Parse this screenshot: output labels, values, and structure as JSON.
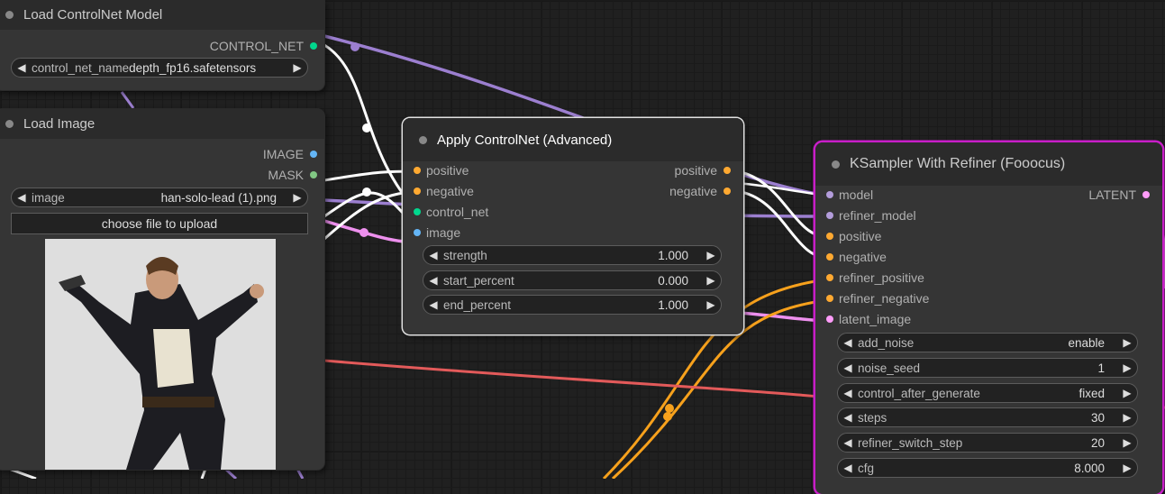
{
  "nodes": {
    "load_controlnet": {
      "title": "Load ControlNet Model",
      "output": "CONTROL_NET",
      "widget": {
        "name": "control_net_name",
        "value": "depth_fp16.safetensors"
      }
    },
    "load_image": {
      "title": "Load Image",
      "outputs": [
        "IMAGE",
        "MASK"
      ],
      "widget": {
        "name": "image",
        "value": "han-solo-lead (1).png"
      },
      "upload_label": "choose file to upload"
    },
    "apply_controlnet": {
      "title": "Apply ControlNet (Advanced)",
      "inputs": [
        "positive",
        "negative",
        "control_net",
        "image"
      ],
      "outputs": [
        "positive",
        "negative"
      ],
      "widgets": [
        {
          "name": "strength",
          "value": "1.000"
        },
        {
          "name": "start_percent",
          "value": "0.000"
        },
        {
          "name": "end_percent",
          "value": "1.000"
        }
      ]
    },
    "ksampler": {
      "title": "KSampler With Refiner (Fooocus)",
      "inputs": [
        "model",
        "refiner_model",
        "positive",
        "negative",
        "refiner_positive",
        "refiner_negative",
        "latent_image"
      ],
      "output": "LATENT",
      "widgets": [
        {
          "name": "add_noise",
          "value": "enable"
        },
        {
          "name": "noise_seed",
          "value": "1"
        },
        {
          "name": "control_after_generate",
          "value": "fixed"
        },
        {
          "name": "steps",
          "value": "30"
        },
        {
          "name": "refiner_switch_step",
          "value": "20"
        },
        {
          "name": "cfg",
          "value": "8.000"
        }
      ]
    }
  },
  "colors": {
    "canvas": "#202020",
    "node_body": "#353535",
    "node_header": "#2b2b2b",
    "selected_outline": "#e0e0e0",
    "running_outline": "#c81ec8",
    "conditioning_pin": "#ffa931",
    "control_net_pin": "#00d78d",
    "image_pin": "#64b5f6",
    "mask_pin": "#81c784",
    "model_pin": "#b39ddb",
    "latent_pin": "#ff9cf9",
    "wire_model": "#9c7fd0",
    "wire_conditioning": "#ffffff",
    "wire_latent": "#ee90ee",
    "wire_positive_orange": "#f7a11c",
    "wire_red": "#e35a5a"
  },
  "icons": {
    "left_arrow": "◀",
    "right_arrow": "▶"
  }
}
